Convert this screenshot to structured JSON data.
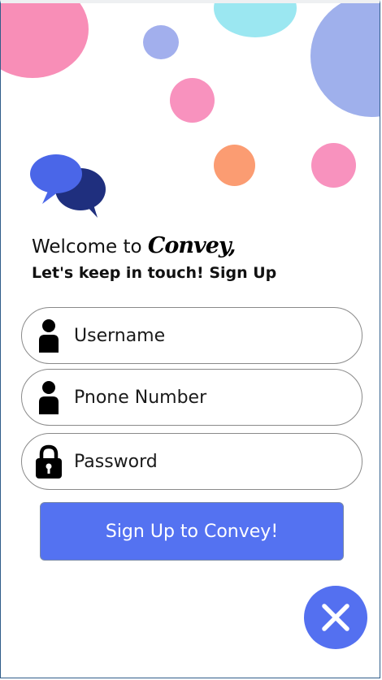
{
  "welcome": {
    "prefix": "Welcome to ",
    "brand": "Convey,",
    "subtitle": "Let's keep in touch! Sign Up"
  },
  "form": {
    "username_placeholder": "Username",
    "phone_placeholder": "Pnone Number",
    "password_placeholder": "Password",
    "submit_label": "Sign Up to Convey!"
  },
  "icons": {
    "logo": "chat-bubbles-icon",
    "username": "user-icon",
    "phone": "user-icon",
    "password": "lock-icon",
    "close": "close-icon"
  },
  "colors": {
    "accent": "#5472f1",
    "logo_front": "#4a66e8",
    "logo_back": "#1f2f7e"
  }
}
